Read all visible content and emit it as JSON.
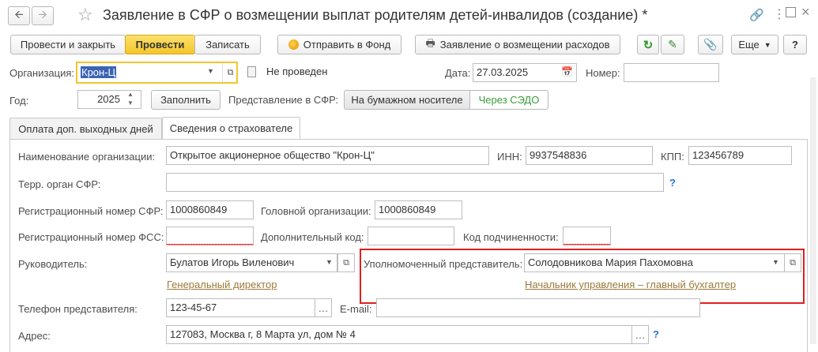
{
  "window": {
    "title": "Заявление в СФР о возмещении выплат родителям детей-инвалидов (создание) *"
  },
  "toolbar": {
    "post_and_close": "Провести и закрыть",
    "post": "Провести",
    "save": "Записать",
    "send_to_fund": "Отправить в Фонд",
    "report_menu": "Заявление о возмещении расходов",
    "more": "Еще"
  },
  "header": {
    "org_label": "Организация:",
    "org_value": "Крон-Ц",
    "status": "Не проведен",
    "date_label": "Дата:",
    "date_value": "27.03.2025",
    "number_label": "Номер:",
    "number_value": "",
    "year_label": "Год:",
    "year_value": "2025",
    "fill_button": "Заполнить",
    "submission_label": "Представление в СФР:",
    "submission_options": [
      "На бумажном носителе",
      "Через СЭДО"
    ]
  },
  "tabs": [
    "Оплата доп. выходных дней",
    "Сведения о страхователе"
  ],
  "insurer": {
    "org_name_label": "Наименование организации:",
    "org_name_value": "Открытое акционерное общество \"Крон-Ц\"",
    "inn_label": "ИНН:",
    "inn_value": "9937548836",
    "kpp_label": "КПП:",
    "kpp_value": "123456789",
    "sfr_office_label": "Терр. орган СФР:",
    "sfr_office_value": "",
    "sfr_reg_label": "Регистрационный номер СФР:",
    "sfr_reg_value": "1000860849",
    "head_org_label": "Головной организации:",
    "head_org_value": "1000860849",
    "fss_reg_label": "Регистрационный номер ФСС:",
    "fss_reg_value": "",
    "extra_code_label": "Дополнительный код:",
    "extra_code_value": "",
    "sub_code_label": "Код подчиненности:",
    "sub_code_value": "",
    "director_label": "Руководитель:",
    "director_value": "Булатов Игорь Виленович",
    "director_position": "Генеральный директор",
    "rep_label": "Уполномоченный представитель:",
    "rep_value": "Солодовникова Мария Пахомовна",
    "rep_position": "Начальник управления – главный бухгалтер",
    "phone_label": "Телефон представителя:",
    "phone_value": "123-45-67",
    "email_label": "E-mail:",
    "email_value": "",
    "address_label": "Адрес:",
    "address_value": "127083, Москва г, 8 Марта ул, дом № 4",
    "help": "?"
  },
  "colors": {
    "accent_yellow": "#f3c52c",
    "highlight_red": "#e02020",
    "link_brown": "#9b7a39",
    "sedo_green": "#3a9a3a"
  }
}
